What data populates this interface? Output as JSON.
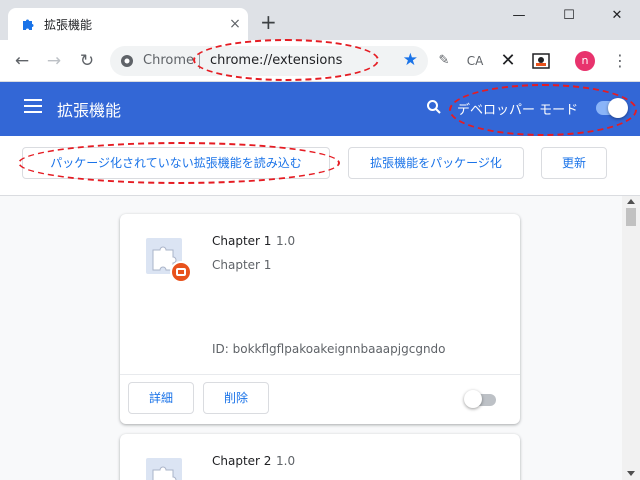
{
  "tab": {
    "title": "拡張機能",
    "icon": "puzzle-icon",
    "close": "×"
  },
  "window": {
    "new_tab": "+",
    "minimize": "—",
    "maximize": "☐",
    "close": "✕"
  },
  "omnibox": {
    "scheme": "Chrome",
    "url": "chrome://extensions",
    "star_icon": "star-icon"
  },
  "extension_icons": [
    "CA"
  ],
  "profile": {
    "initial": "n",
    "color": "#e8336d"
  },
  "header": {
    "title": "拡張機能",
    "dev_mode_label": "デベロッパー モード",
    "dev_mode_enabled": true
  },
  "dev_toolbar": {
    "load_unpacked": "パッケージ化されていない拡張機能を読み込む",
    "pack": "拡張機能をパッケージ化",
    "update": "更新"
  },
  "extensions": [
    {
      "name": "Chapter 1",
      "version": "1.0",
      "description": "Chapter 1",
      "id_label": "ID: bokkflgflpakoakeignnbaaapjgcgndo",
      "details_label": "詳細",
      "remove_label": "削除",
      "enabled": false
    },
    {
      "name": "Chapter 2",
      "version": "1.0"
    }
  ],
  "colors": {
    "header": "#3367d6",
    "accent": "#1a73e8",
    "annotation": "#e51c23"
  }
}
